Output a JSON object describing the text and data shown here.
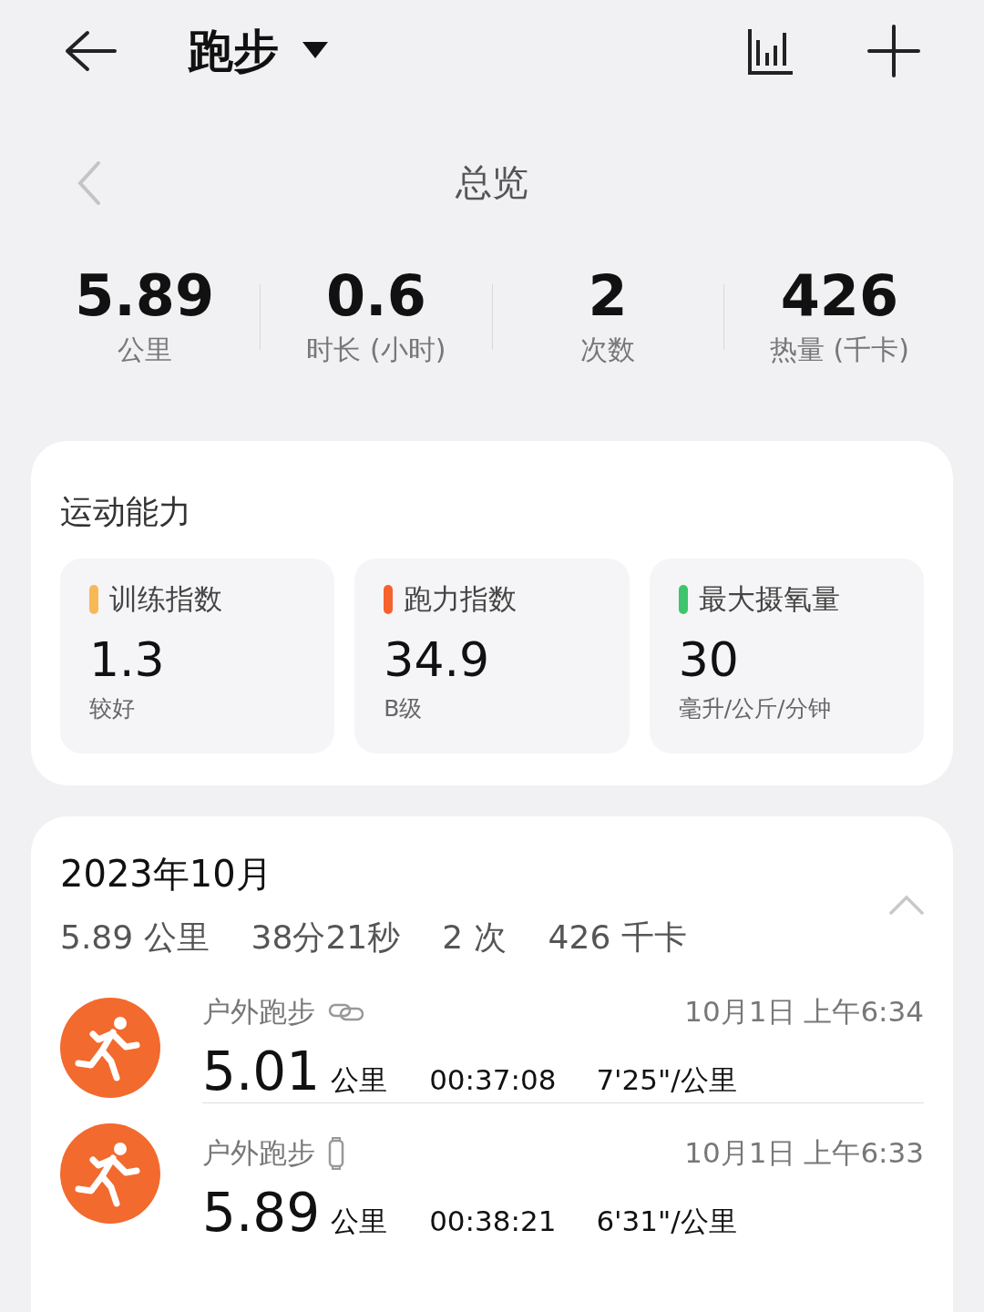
{
  "header": {
    "title": "跑步"
  },
  "overview": {
    "title": "总览",
    "stats": [
      {
        "value": "5.89",
        "label": "公里"
      },
      {
        "value": "0.6",
        "label": "时长 (小时)"
      },
      {
        "value": "2",
        "label": "次数"
      },
      {
        "value": "426",
        "label": "热量 (千卡)"
      }
    ]
  },
  "ability": {
    "title": "运动能力",
    "cards": [
      {
        "label": "训练指数",
        "value": "1.3",
        "note": "较好",
        "color": "#f7b955"
      },
      {
        "label": "跑力指数",
        "value": "34.9",
        "note": "B级",
        "color": "#f5622d"
      },
      {
        "label": "最大摄氧量",
        "value": "30",
        "note": "毫升/公斤/分钟",
        "color": "#3ec46d"
      }
    ]
  },
  "month": {
    "title": "2023年10月",
    "expanded": true,
    "summary": [
      "5.89 公里",
      "38分21秒",
      "2 次",
      "426 千卡"
    ],
    "records": [
      {
        "name": "户外跑步",
        "kind": "link",
        "time": "10月1日 上午6:34",
        "distance": "5.01",
        "unit": "公里",
        "duration": "00:37:08",
        "pace": "7'25\"/公里"
      },
      {
        "name": "户外跑步",
        "kind": "band",
        "time": "10月1日 上午6:33",
        "distance": "5.89",
        "unit": "公里",
        "duration": "00:38:21",
        "pace": "6'31\"/公里"
      }
    ]
  }
}
